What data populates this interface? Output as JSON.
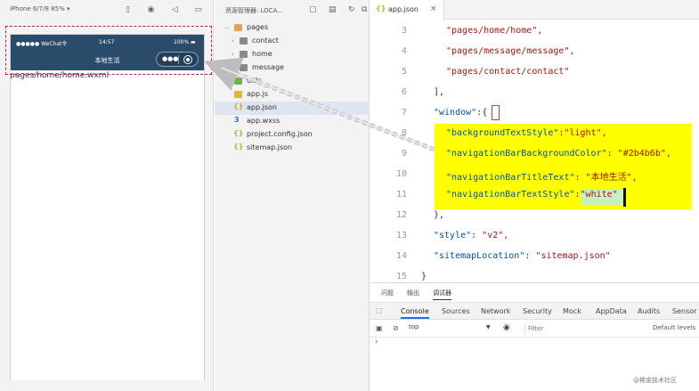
{
  "simulator": {
    "device_label": "iPhone 6/7/8 85% ▾",
    "status": {
      "carrier": "●●●●● WeChat令",
      "time": "14:57",
      "battery": "100% ▬"
    },
    "nav_title": "本地生活",
    "capsule_dots": "●●●",
    "page_path": "pages/home/home.wxml",
    "nav_bg": "#2b4b6b"
  },
  "explorer": {
    "title": "资源管理器: LOCA...",
    "tree": [
      {
        "label": "pages",
        "icon": "folder-open-icon"
      },
      {
        "label": "contact",
        "icon": "folder-icon"
      },
      {
        "label": "home",
        "icon": "folder-icon"
      },
      {
        "label": "message",
        "icon": "folder-icon"
      },
      {
        "label": "utils",
        "icon": "folder-icon"
      },
      {
        "label": "app.js",
        "icon": "js-file-icon"
      },
      {
        "label": "app.json",
        "icon": "json-file-icon"
      },
      {
        "label": "app.wxss",
        "icon": "css-file-icon"
      },
      {
        "label": "project.config.json",
        "icon": "json-file-icon"
      },
      {
        "label": "sitemap.json",
        "icon": "json-file-icon"
      }
    ]
  },
  "editor": {
    "tab": {
      "icon_text": "{}",
      "label": "app.json",
      "close": "×"
    },
    "line_numbers": [
      "3",
      "4",
      "5",
      "6",
      "7",
      "8",
      "9",
      "10",
      "11",
      "12",
      "13",
      "14",
      "15"
    ],
    "lines": {
      "l3": "\"pages/home/home\",",
      "l4": "\"pages/message/message\",",
      "l5": "\"pages/contact/contact\"",
      "l6": "],",
      "l7_key": "\"window\"",
      "l7_rest": ":{",
      "l8_key": "\"backgroundTextStyle\"",
      "l8_val": "\"light\",",
      "l9_key": "\"navigationBarBackgroundColor\"",
      "l9_val": "\"#2b4b6b\",",
      "l10_key": "\"navigationBarTitleText\"",
      "l10_val": "\"本地生活\",",
      "l11_key": "\"navigationBarTextStyle\"",
      "l11_val": "\"white\"",
      "l12": "},",
      "l13_key": "\"style\"",
      "l13_val": "\"v2\",",
      "l14_key": "\"sitemapLocation\"",
      "l14_val": "\"sitemap.json\"",
      "l15": "}"
    },
    "colon": ": ",
    "colon_tight": ":",
    "highlight_color": "#ffff00"
  },
  "console": {
    "panel_tabs": [
      "问题",
      "输出",
      "调试器"
    ],
    "dev_tabs": [
      "Console",
      "Sources",
      "Network",
      "Security",
      "Mock",
      "AppData",
      "Audits",
      "Sensor"
    ],
    "context": "top",
    "filter_placeholder": "Filter",
    "levels": "Default levels",
    "prompt": "›",
    "watermark": "@稀金技术社区"
  }
}
